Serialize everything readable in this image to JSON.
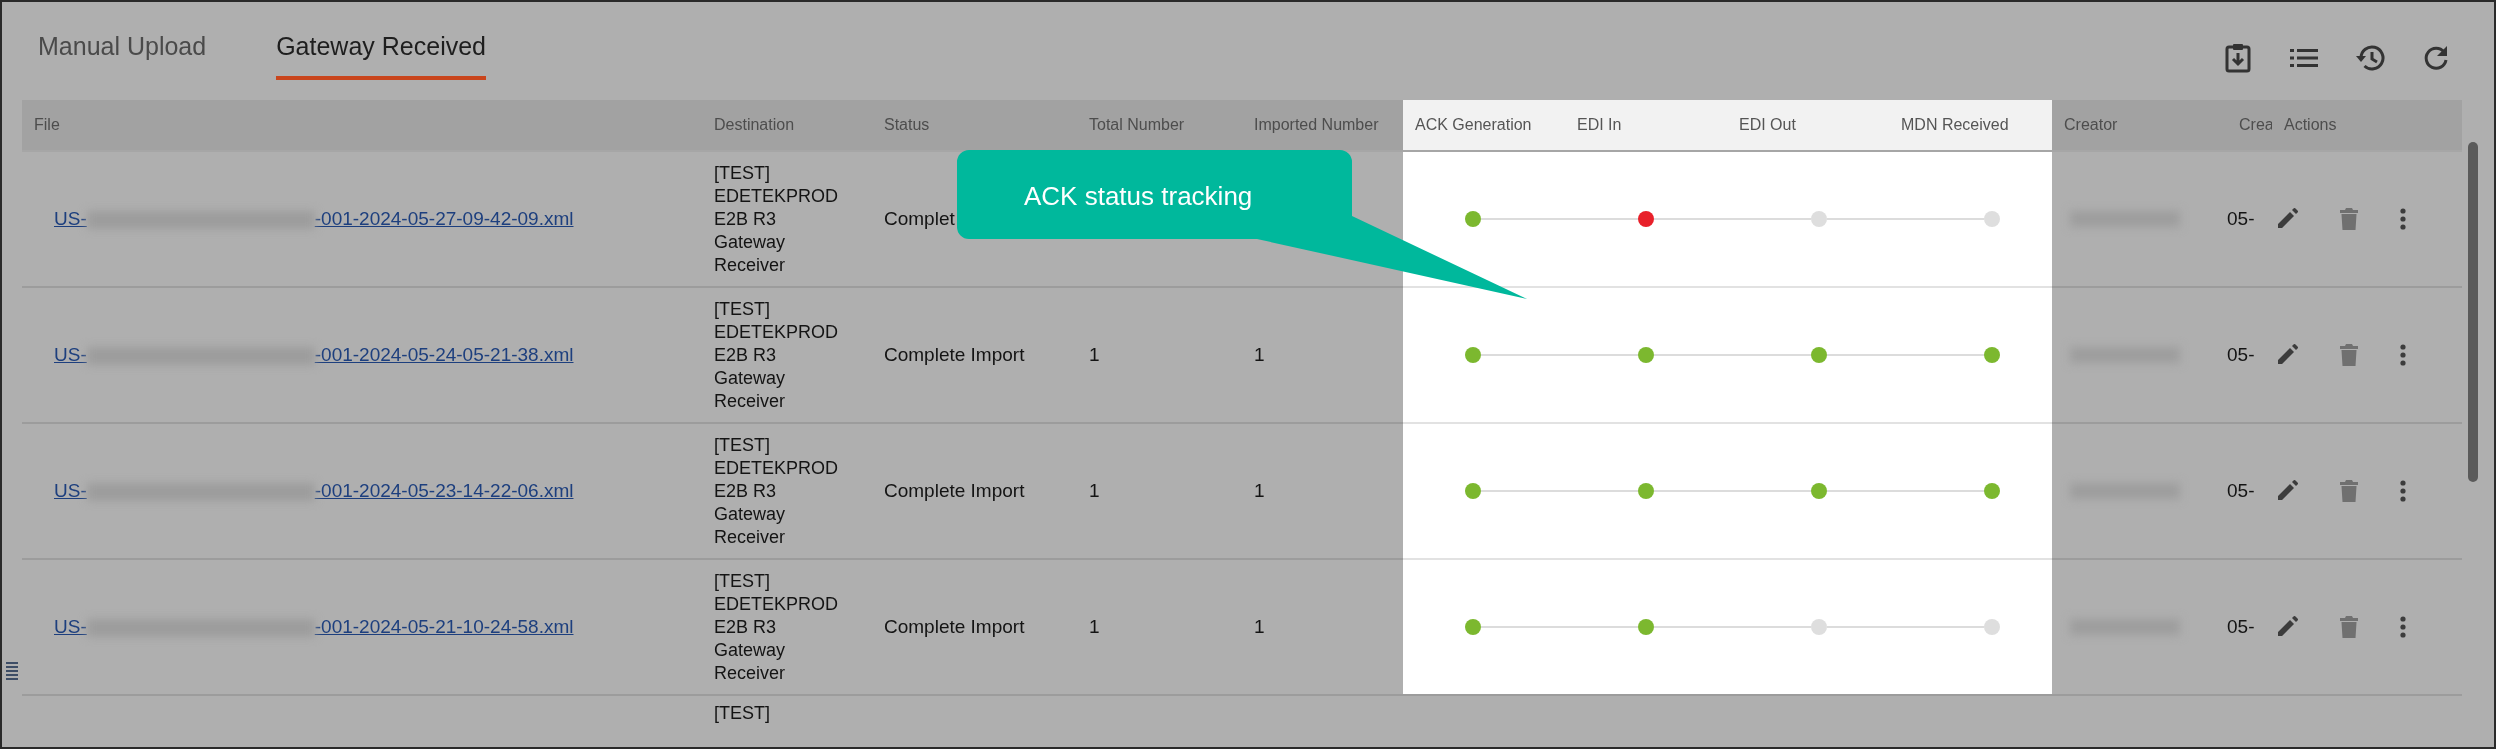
{
  "tabs": [
    {
      "label": "Manual Upload",
      "selected": false
    },
    {
      "label": "Gateway Received",
      "selected": true
    }
  ],
  "columns": [
    "File",
    "Destination",
    "Status",
    "Total Number",
    "Imported Number",
    "ACK Generation",
    "EDI In",
    "EDI Out",
    "MDN Received",
    "Creator",
    "Crea",
    "Actions"
  ],
  "rows": [
    {
      "file_start": "US-",
      "file_end": "-001-2024-05-27-09-42-09.xml",
      "destination": "[TEST] EDETEKPROD E2B R3 Gateway Receiver",
      "status": "Complet",
      "total": "",
      "imported": "",
      "steps": [
        {
          "color": "#7cb82f"
        },
        {
          "color": "#e8202a"
        },
        {
          "color": "#dedede"
        },
        {
          "color": "#dedede"
        }
      ],
      "created": "05-"
    },
    {
      "file_start": "US-",
      "file_end": "-001-2024-05-24-05-21-38.xml",
      "destination": "[TEST] EDETEKPROD E2B R3 Gateway Receiver",
      "status": "Complete Import",
      "total": "1",
      "imported": "1",
      "steps": [
        {
          "color": "#7cb82f"
        },
        {
          "color": "#7cb82f"
        },
        {
          "color": "#7cb82f"
        },
        {
          "color": "#7cb82f"
        }
      ],
      "created": "05-"
    },
    {
      "file_start": "US-",
      "file_end": "-001-2024-05-23-14-22-06.xml",
      "destination": "[TEST] EDETEKPROD E2B R3 Gateway Receiver",
      "status": "Complete Import",
      "total": "1",
      "imported": "1",
      "steps": [
        {
          "color": "#7cb82f"
        },
        {
          "color": "#7cb82f"
        },
        {
          "color": "#7cb82f"
        },
        {
          "color": "#7cb82f"
        }
      ],
      "created": "05-"
    },
    {
      "file_start": "US-",
      "file_end": "-001-2024-05-21-10-24-58.xml",
      "destination": "[TEST] EDETEKPROD E2B R3 Gateway Receiver",
      "status": "Complete Import",
      "total": "1",
      "imported": "1",
      "steps": [
        {
          "color": "#7cb82f"
        },
        {
          "color": "#7cb82f"
        },
        {
          "color": "#dedede"
        },
        {
          "color": "#dedede"
        }
      ],
      "created": "05-"
    }
  ],
  "partial_row": {
    "destination": "[TEST]"
  },
  "callout": {
    "text": "ACK status tracking"
  }
}
